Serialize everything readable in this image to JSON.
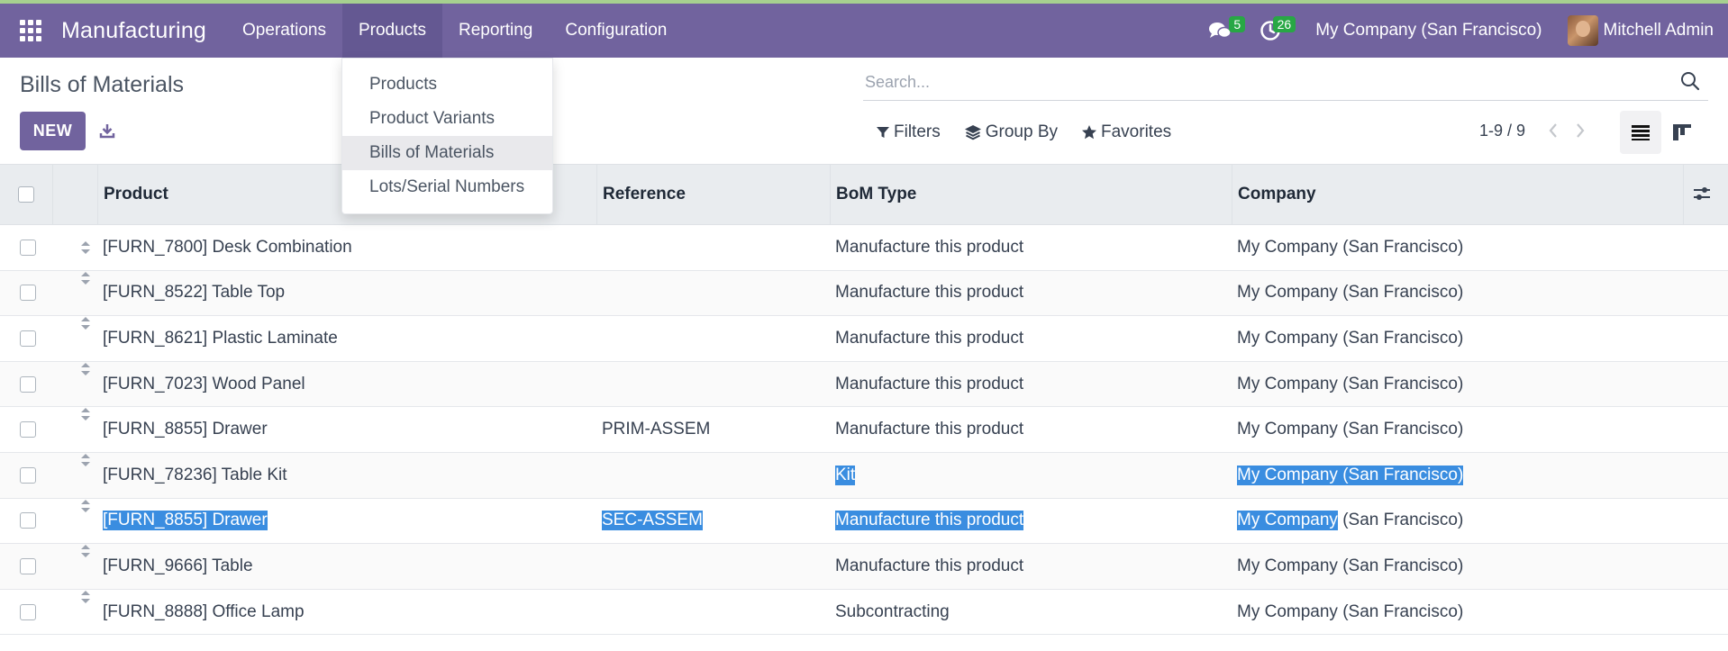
{
  "navbar": {
    "app_name": "Manufacturing",
    "menus": [
      "Operations",
      "Products",
      "Reporting",
      "Configuration"
    ],
    "active_menu": "Products",
    "messages_badge": "5",
    "activities_badge": "26",
    "company": "My Company (San Francisco)",
    "user": "Mitchell Admin",
    "bar_color": "#71639e"
  },
  "products_menu": {
    "items": [
      "Products",
      "Product Variants",
      "Bills of Materials",
      "Lots/Serial Numbers"
    ],
    "active": "Bills of Materials"
  },
  "control_panel": {
    "title": "Bills of Materials",
    "new_label": "NEW",
    "search_placeholder": "Search...",
    "filters_label": "Filters",
    "group_by_label": "Group By",
    "favorites_label": "Favorites",
    "pager": "1-9 / 9"
  },
  "table": {
    "columns": [
      "Product",
      "Reference",
      "BoM Type",
      "Company"
    ],
    "rows": [
      {
        "product": "[FURN_7800] Desk Combination",
        "reference": "",
        "bom_type": "Manufacture this product",
        "company": "My Company (San Francisco)"
      },
      {
        "product": "[FURN_8522] Table Top",
        "reference": "",
        "bom_type": "Manufacture this product",
        "company": "My Company (San Francisco)"
      },
      {
        "product": "[FURN_8621] Plastic Laminate",
        "reference": "",
        "bom_type": "Manufacture this product",
        "company": "My Company (San Francisco)"
      },
      {
        "product": "[FURN_7023] Wood Panel",
        "reference": "",
        "bom_type": "Manufacture this product",
        "company": "My Company (San Francisco)"
      },
      {
        "product": "[FURN_8855] Drawer",
        "reference": "PRIM-ASSEM",
        "bom_type": "Manufacture this product",
        "company": "My Company (San Francisco)"
      },
      {
        "product": "[FURN_78236] Table Kit",
        "reference": "",
        "bom_type": "Kit",
        "company": "My Company (San Francisco)"
      },
      {
        "product": "[FURN_8855] Drawer",
        "reference": "SEC-ASSEM",
        "bom_type": "Manufacture this product",
        "company_sel": "My Company",
        "company_rest": " (San Francisco)"
      },
      {
        "product": "[FURN_9666] Table",
        "reference": "",
        "bom_type": "Manufacture this product",
        "company": "My Company (San Francisco)"
      },
      {
        "product": "[FURN_8888] Office Lamp",
        "reference": "",
        "bom_type": "Subcontracting",
        "company": "My Company (San Francisco)"
      }
    ],
    "selection_color": "#3a8de0"
  }
}
